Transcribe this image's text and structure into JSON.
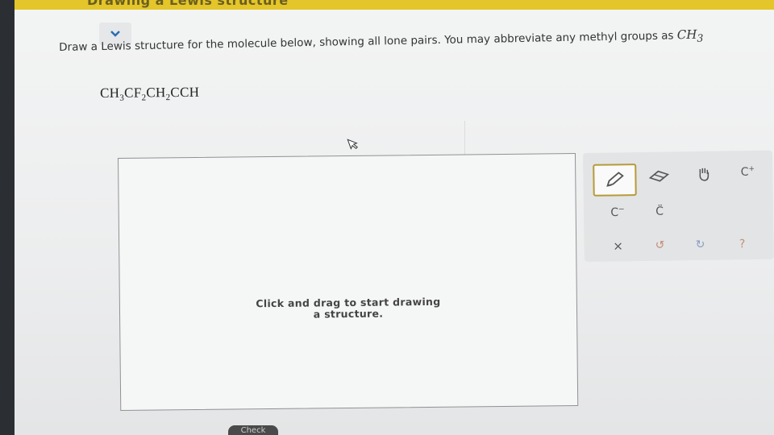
{
  "header": {
    "title": "Drawing a Lewis structure"
  },
  "question": {
    "text": "Draw a Lewis structure for the molecule below, showing all lone pairs. You may abbreviate any methyl groups as",
    "methyl_abbrev": "CH",
    "methyl_sub": "3"
  },
  "formula": {
    "parts": [
      "CH",
      "3",
      "CF",
      "2",
      "CH",
      "2",
      "CCH"
    ]
  },
  "canvas": {
    "hint_line1": "Click and drag to start drawing",
    "hint_line2": "a structure."
  },
  "toolbar": {
    "pencil": "pencil-icon",
    "eraser": "eraser-icon",
    "hand": "hand-icon",
    "cation_base": "C",
    "cation_charge": "+",
    "anion_base": "C",
    "anion_charge": "−",
    "lone_pair_label": "C̈",
    "clear_label": "×",
    "undo_label": "↺",
    "redo_label": "↻",
    "help_label": "?"
  },
  "footer": {
    "check_label": "Check"
  },
  "colors": {
    "header": "#e4c52a",
    "accent": "#2a6db3",
    "active_tool_border": "#b89a3a"
  }
}
